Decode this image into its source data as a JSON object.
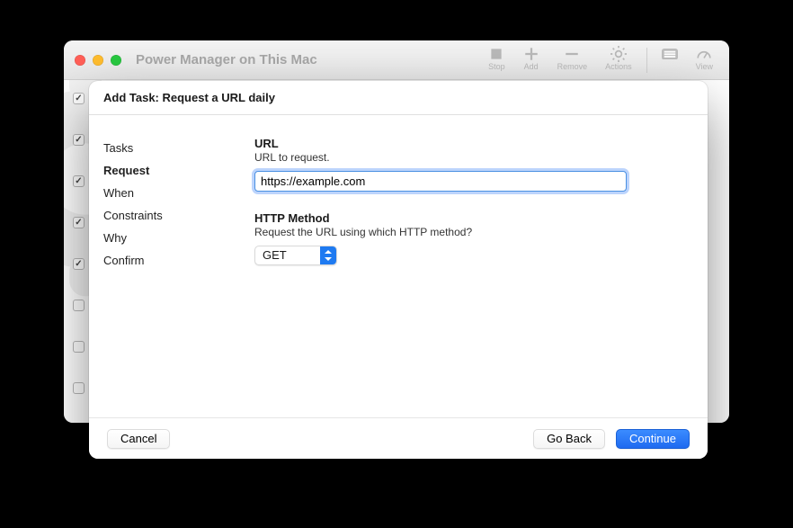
{
  "bgWindow": {
    "title": "Power Manager on This Mac",
    "toolbar": {
      "stop": "Stop",
      "add": "Add",
      "remove": "Remove",
      "actions": "Actions",
      "view": "View"
    },
    "rows": [
      {
        "checked": true
      },
      {
        "checked": true
      },
      {
        "checked": true
      },
      {
        "checked": true
      },
      {
        "checked": true
      },
      {
        "checked": false
      },
      {
        "checked": false
      },
      {
        "checked": false
      }
    ]
  },
  "sheet": {
    "title": "Add Task: Request a URL daily",
    "sidebar": [
      "Tasks",
      "Request",
      "When",
      "Constraints",
      "Why",
      "Confirm"
    ],
    "sidebarActiveIndex": 1,
    "url": {
      "label": "URL",
      "desc": "URL to request.",
      "value": "https://example.com"
    },
    "method": {
      "label": "HTTP Method",
      "desc": "Request the URL using which HTTP method?",
      "value": "GET"
    },
    "buttons": {
      "cancel": "Cancel",
      "back": "Go Back",
      "continue": "Continue"
    }
  }
}
